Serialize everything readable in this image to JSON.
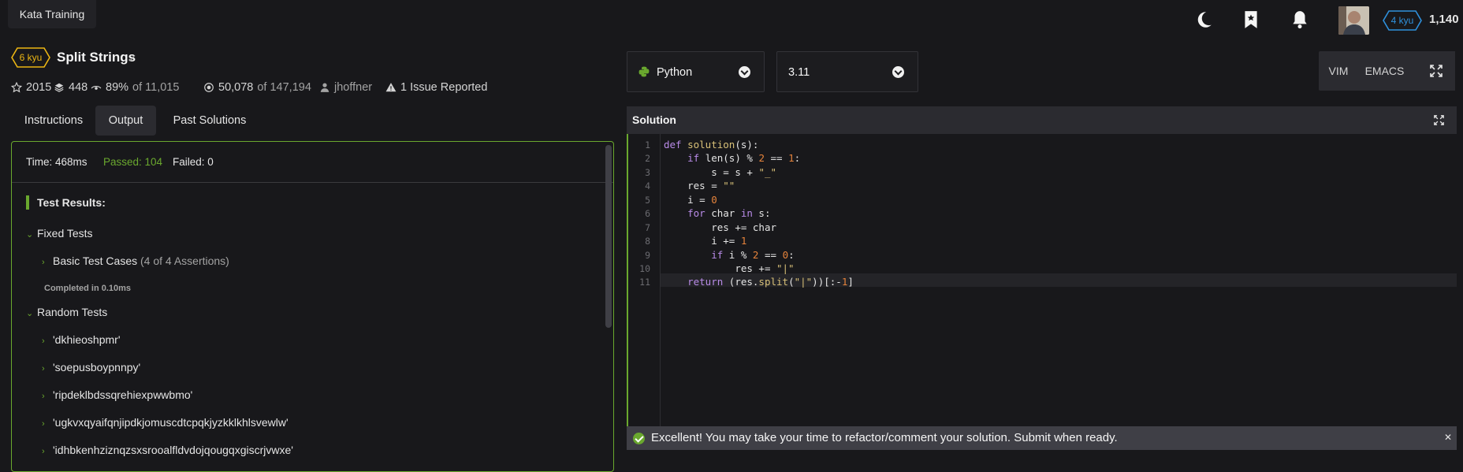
{
  "topbar": {
    "tab_label": "Kata Training",
    "rank": "4 kyu",
    "honor": "1,140"
  },
  "kata": {
    "rank": "6 kyu",
    "title": "Split Strings",
    "title_mark": "✓",
    "stats": {
      "stars": "2015",
      "collections": "448",
      "satisfaction": "89%",
      "satisfaction_of": "of 11,015",
      "completed": "50,078",
      "completed_of": "of 147,194",
      "author": "jhoffner",
      "issues": "1 Issue Reported"
    }
  },
  "tabs": [
    {
      "label": "Instructions"
    },
    {
      "label": "Output",
      "active": true
    },
    {
      "label": "Past Solutions"
    }
  ],
  "output": {
    "time": "Time: 468ms",
    "passed": "Passed: 104",
    "failed": "Failed: 0",
    "results_header": "Test Results:",
    "fixed_group": "Fixed Tests",
    "basic_cases": "Basic Test Cases",
    "basic_assertions": "(4 of 4 Assertions)",
    "completed": "Completed in 0.10ms",
    "random_group": "Random Tests",
    "random_items": [
      "'dkhieoshpmr'",
      "'soepusboypnnpy'",
      "'ripdeklbdssqrehiexpwwbmo'",
      "'ugkvxqyaifqnjipdkjomuscdtcpqkjyzkklkhlsvewlw'",
      "'idhbkenhziznqzsxsrooalfldvdojqougqxgiscrjvwxe'"
    ]
  },
  "editor": {
    "language": "Python",
    "version": "3.11",
    "vim_label": "VIM",
    "emacs_label": "EMACS",
    "solution_title": "Solution",
    "line_numbers": [
      "1",
      "2",
      "3",
      "4",
      "5",
      "6",
      "7",
      "8",
      "9",
      "10",
      "11"
    ],
    "code": {
      "l1_kw": "def",
      "l1_fn": "solution",
      "l1_rest": "(s):",
      "l2_kw": "if",
      "l2_a": " len(s) % ",
      "l2_n1": "2",
      "l2_b": " == ",
      "l2_n2": "1",
      "l2_c": ":",
      "l3_a": "s = s + ",
      "l3_s": "\"_\"",
      "l4_a": "res = ",
      "l4_s": "\"\"",
      "l5_a": "i = ",
      "l5_n": "0",
      "l6_kw": "for",
      "l6_a": " char ",
      "l6_kw2": "in",
      "l6_b": " s:",
      "l7": "res += char",
      "l8_a": "i += ",
      "l8_n": "1",
      "l9_kw": "if",
      "l9_a": " i % ",
      "l9_n1": "2",
      "l9_b": " == ",
      "l9_n2": "0",
      "l9_c": ":",
      "l10_a": "res += ",
      "l10_s": "\"|\"",
      "l11_kw": "return",
      "l11_a": " (res.",
      "l11_fn": "split",
      "l11_b": "(",
      "l11_s": "\"|\"",
      "l11_c": "))[:-",
      "l11_n": "1",
      "l11_d": "]"
    },
    "success_message": "Excellent! You may take your time to refactor/comment your solution. Submit when ready.",
    "close_glyph": "✕"
  },
  "colors": {
    "accent_green": "#6aa82e",
    "rank_yellow": "#ecb613",
    "rank_blue": "#2f91dd",
    "keyword": "#b98be8",
    "function": "#d8c078",
    "number": "#e5833b"
  },
  "icons": [
    "moon-icon",
    "bookmark-icon",
    "bell-icon",
    "avatar",
    "star-icon",
    "layers-icon",
    "eye-icon",
    "target-icon",
    "user-icon",
    "warning-icon",
    "python-icon",
    "chevron-down-icon",
    "expand-icon",
    "check-circle-icon",
    "close-icon"
  ]
}
